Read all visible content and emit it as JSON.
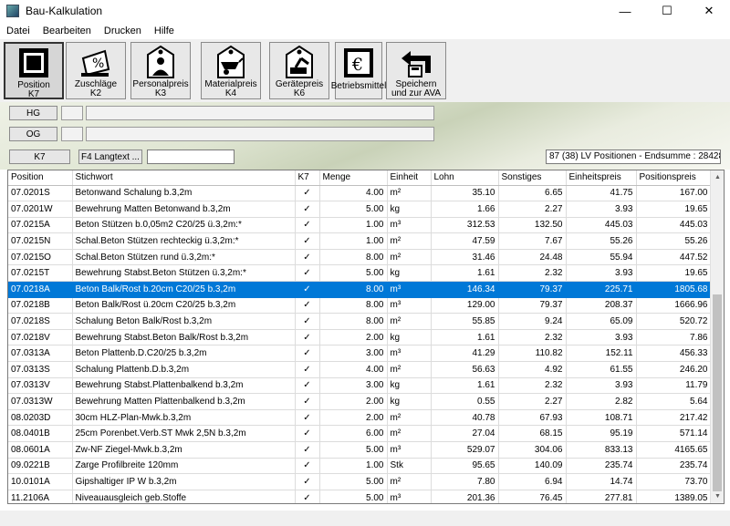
{
  "window": {
    "title": "Bau-Kalkulation",
    "min": "—",
    "max": "☐",
    "close": "✕"
  },
  "menu": [
    "Datei",
    "Bearbeiten",
    "Drucken",
    "Hilfe"
  ],
  "toolbar": [
    {
      "label": "Position\nK7",
      "icon": "position-icon"
    },
    {
      "label": "Zuschläge\nK2",
      "icon": "percent-icon"
    },
    {
      "label": "Personalpreis\nK3",
      "icon": "person-icon"
    },
    {
      "label": "Materialpreis\nK4",
      "icon": "wheelbarrow-icon"
    },
    {
      "label": "Gerätepreis\nK6",
      "icon": "excavator-icon"
    },
    {
      "label": "Betriebsmittel",
      "icon": "euro-icon"
    },
    {
      "label": "Speichern\nund zur AVA",
      "icon": "save-return-icon"
    }
  ],
  "panel": {
    "hg_label": "HG",
    "og_label": "OG",
    "k7_label": "K7",
    "langtext_label": "F4 Langtext ...",
    "summary": "87 (38) LV Positionen - Endsumme : 28428,90"
  },
  "grid": {
    "columns": [
      "Position",
      "Stichwort",
      "K7",
      "Menge",
      "Einheit",
      "Lohn",
      "Sonstiges",
      "Einheitspreis",
      "Positionspreis"
    ],
    "selected_index": 6,
    "rows": [
      [
        "07.0201S",
        "Betonwand Schalung b.3,2m",
        "✓",
        "4.00",
        "m²",
        "35.10",
        "6.65",
        "41.75",
        "167.00"
      ],
      [
        "07.0201W",
        "Bewehrung Matten Betonwand b.3,2m",
        "✓",
        "5.00",
        "kg",
        "1.66",
        "2.27",
        "3.93",
        "19.65"
      ],
      [
        "07.0215A",
        "Beton Stützen b.0,05m2 C20/25 ü.3,2m:*",
        "✓",
        "1.00",
        "m³",
        "312.53",
        "132.50",
        "445.03",
        "445.03"
      ],
      [
        "07.0215N",
        "Schal.Beton Stützen rechteckig ü.3,2m:*",
        "✓",
        "1.00",
        "m²",
        "47.59",
        "7.67",
        "55.26",
        "55.26"
      ],
      [
        "07.0215O",
        "Schal.Beton Stützen rund ü.3,2m:*",
        "✓",
        "8.00",
        "m²",
        "31.46",
        "24.48",
        "55.94",
        "447.52"
      ],
      [
        "07.0215T",
        "Bewehrung Stabst.Beton Stützen ü.3,2m:*",
        "✓",
        "5.00",
        "kg",
        "1.61",
        "2.32",
        "3.93",
        "19.65"
      ],
      [
        "07.0218A",
        "Beton Balk/Rost b.20cm C20/25 b.3,2m",
        "✓",
        "8.00",
        "m³",
        "146.34",
        "79.37",
        "225.71",
        "1805.68"
      ],
      [
        "07.0218B",
        "Beton Balk/Rost ü.20cm C20/25 b.3,2m",
        "✓",
        "8.00",
        "m³",
        "129.00",
        "79.37",
        "208.37",
        "1666.96"
      ],
      [
        "07.0218S",
        "Schalung Beton Balk/Rost b.3,2m",
        "✓",
        "8.00",
        "m²",
        "55.85",
        "9.24",
        "65.09",
        "520.72"
      ],
      [
        "07.0218V",
        "Bewehrung Stabst.Beton Balk/Rost b.3,2m",
        "✓",
        "2.00",
        "kg",
        "1.61",
        "2.32",
        "3.93",
        "7.86"
      ],
      [
        "07.0313A",
        "Beton Plattenb.D.C20/25 b.3,2m",
        "✓",
        "3.00",
        "m³",
        "41.29",
        "110.82",
        "152.11",
        "456.33"
      ],
      [
        "07.0313S",
        "Schalung Plattenb.D.b.3,2m",
        "✓",
        "4.00",
        "m²",
        "56.63",
        "4.92",
        "61.55",
        "246.20"
      ],
      [
        "07.0313V",
        "Bewehrung Stabst.Plattenbalkend b.3,2m",
        "✓",
        "3.00",
        "kg",
        "1.61",
        "2.32",
        "3.93",
        "11.79"
      ],
      [
        "07.0313W",
        "Bewehrung Matten Plattenbalkend b.3,2m",
        "✓",
        "2.00",
        "kg",
        "0.55",
        "2.27",
        "2.82",
        "5.64"
      ],
      [
        "08.0203D",
        "30cm HLZ-Plan-Mwk.b.3,2m",
        "✓",
        "2.00",
        "m²",
        "40.78",
        "67.93",
        "108.71",
        "217.42"
      ],
      [
        "08.0401B",
        "25cm Porenbet.Verb.ST Mwk 2,5N b.3,2m",
        "✓",
        "6.00",
        "m²",
        "27.04",
        "68.15",
        "95.19",
        "571.14"
      ],
      [
        "08.0601A",
        "Zw-NF Ziegel-Mwk.b.3,2m",
        "✓",
        "5.00",
        "m³",
        "529.07",
        "304.06",
        "833.13",
        "4165.65"
      ],
      [
        "09.0221B",
        "Zarge Profilbreite 120mm",
        "✓",
        "1.00",
        "Stk",
        "95.65",
        "140.09",
        "235.74",
        "235.74"
      ],
      [
        "10.0101A",
        "Gipshaltiger IP W b.3,2m",
        "✓",
        "5.00",
        "m²",
        "7.80",
        "6.94",
        "14.74",
        "73.70"
      ],
      [
        "11.2106A",
        "Niveauausgleich geb.Stoffe",
        "✓",
        "5.00",
        "m³",
        "201.36",
        "76.45",
        "277.81",
        "1389.05"
      ]
    ]
  }
}
